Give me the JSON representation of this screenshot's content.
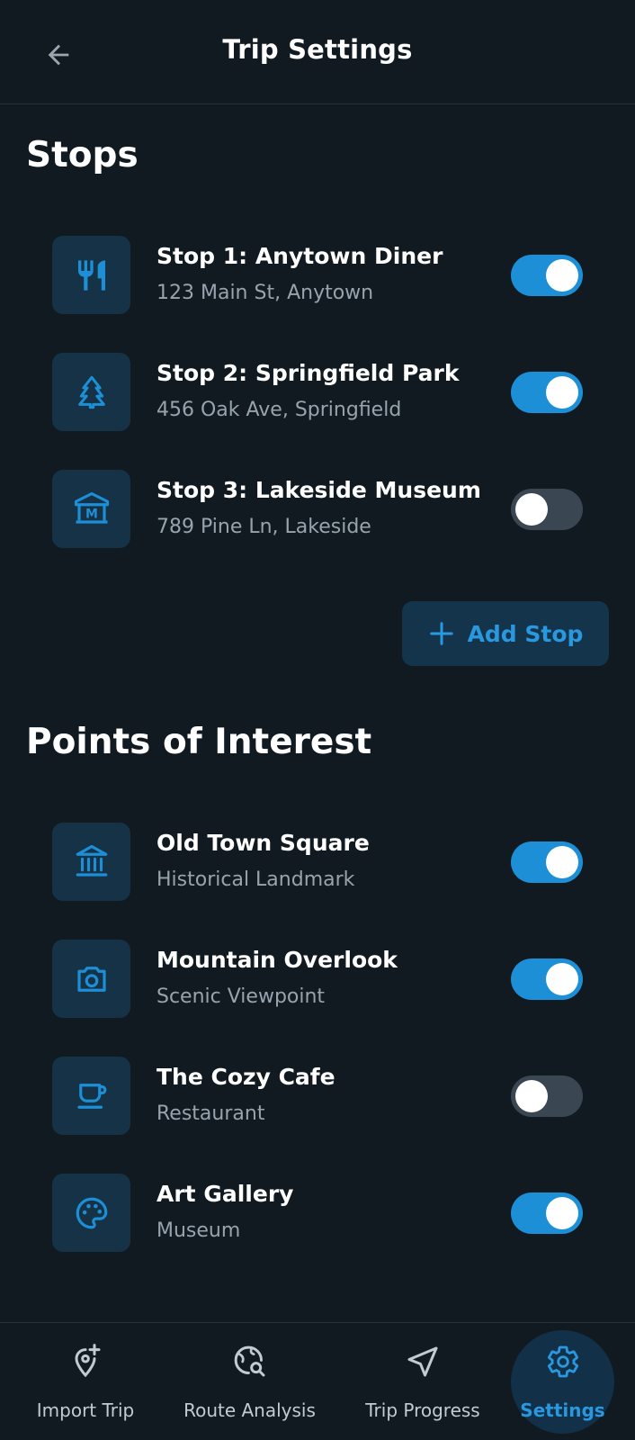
{
  "header": {
    "title": "Trip Settings"
  },
  "stops": {
    "title": "Stops",
    "items": [
      {
        "title": "Stop 1: Anytown Diner",
        "subtitle": "123 Main St, Anytown",
        "icon": "restaurant-icon",
        "enabled": true
      },
      {
        "title": "Stop 2: Springfield Park",
        "subtitle": "456 Oak Ave, Springfield",
        "icon": "tree-icon",
        "enabled": true
      },
      {
        "title": "Stop 3: Lakeside Museum",
        "subtitle": "789 Pine Ln, Lakeside",
        "icon": "museum-icon",
        "enabled": false
      }
    ],
    "add_label": "Add Stop"
  },
  "poi": {
    "title": "Points of Interest",
    "items": [
      {
        "title": "Old Town Square",
        "subtitle": "Historical Landmark",
        "icon": "landmark-icon",
        "enabled": true
      },
      {
        "title": "Mountain Overlook",
        "subtitle": "Scenic Viewpoint",
        "icon": "camera-icon",
        "enabled": true
      },
      {
        "title": "The Cozy Cafe",
        "subtitle": "Restaurant",
        "icon": "coffee-icon",
        "enabled": false
      },
      {
        "title": "Art Gallery",
        "subtitle": "Museum",
        "icon": "palette-icon",
        "enabled": true
      }
    ]
  },
  "nav": {
    "items": [
      {
        "label": "Import Trip",
        "icon": "add-location-icon",
        "active": false
      },
      {
        "label": "Route Analysis",
        "icon": "travel-explore-icon",
        "active": false
      },
      {
        "label": "Trip Progress",
        "icon": "navigation-icon",
        "active": false
      },
      {
        "label": "Settings",
        "icon": "gear-icon",
        "active": true
      }
    ]
  },
  "colors": {
    "background": "#111a21",
    "accent": "#1d8fd6",
    "accent_text": "#2a98df",
    "tile": "#163246",
    "toggle_off": "#3a4652",
    "subtitle": "#97a3ad"
  }
}
